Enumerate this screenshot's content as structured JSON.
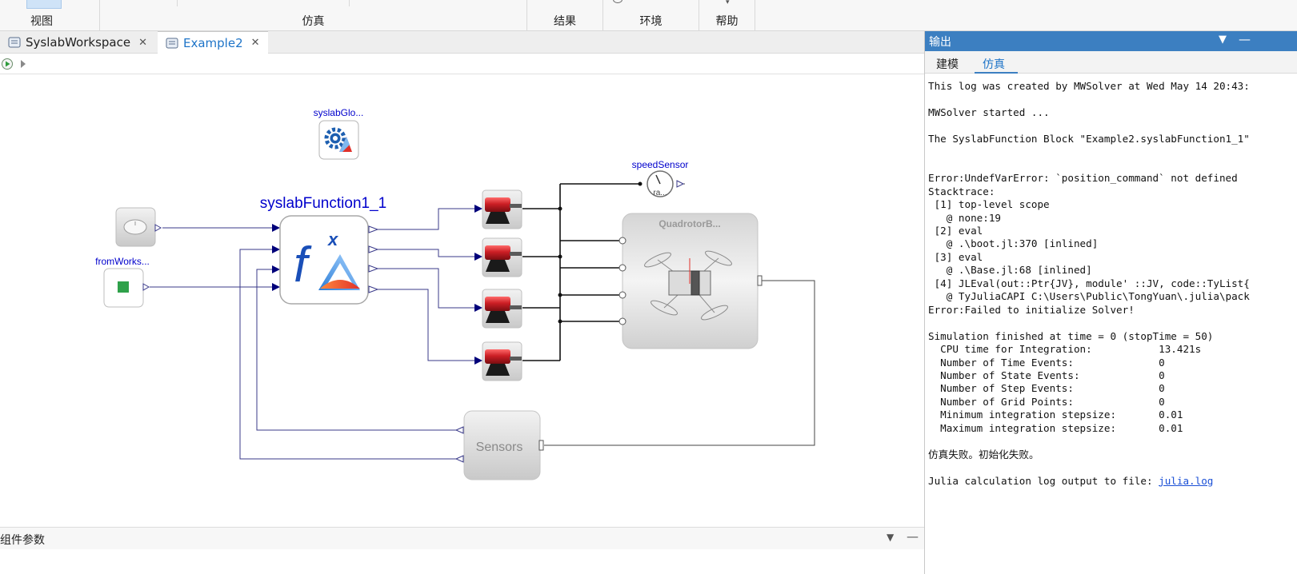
{
  "ribbon": {
    "groups": [
      {
        "label": "视图"
      },
      {
        "label": "仿真"
      },
      {
        "label": "结果"
      },
      {
        "label": "环境"
      },
      {
        "label": "帮助"
      }
    ]
  },
  "editor_tabs": [
    {
      "label": "SyslabWorkspace",
      "active": false
    },
    {
      "label": "Example2",
      "active": true
    }
  ],
  "diagram": {
    "blocks": {
      "global": {
        "label": "syslabGlo..."
      },
      "function": {
        "label": "syslabFunction1_1"
      },
      "from_workspace": {
        "label": "fromWorks..."
      },
      "speed_sensor": {
        "label": "speedSensor",
        "inner": "ra..."
      },
      "quadrotor": {
        "label": "QuadrotorB..."
      },
      "sensors": {
        "label": "Sensors"
      }
    },
    "colors": {
      "label_blue": "#0000cc",
      "wire": "#3a3a8a",
      "motor_red": "#cc1f25"
    }
  },
  "bottom_panel": {
    "title": "组件参数"
  },
  "output_panel": {
    "title": "输出",
    "tabs": [
      {
        "label": "建模",
        "active": false
      },
      {
        "label": "仿真",
        "active": true
      }
    ],
    "log_lines": [
      "This log was created by MWSolver at Wed May 14 20:43:",
      "",
      "MWSolver started ...",
      "",
      "The SyslabFunction Block \"Example2.syslabFunction1_1\"",
      "",
      "",
      "Error:UndefVarError: `position_command` not defined",
      "Stacktrace:",
      " [1] top-level scope",
      "   @ none:19",
      " [2] eval",
      "   @ .\\boot.jl:370 [inlined]",
      " [3] eval",
      "   @ .\\Base.jl:68 [inlined]",
      " [4] JLEval(out::Ptr{JV}, module' ::JV, code::TyList{",
      "   @ TyJuliaCAPI C:\\Users\\Public\\TongYuan\\.julia\\pack",
      "Error:Failed to initialize Solver!",
      "",
      "Simulation finished at time = 0 (stopTime = 50)",
      "  CPU time for Integration:           13.421s",
      "  Number of Time Events:              0",
      "  Number of State Events:             0",
      "  Number of Step Events:              0",
      "  Number of Grid Points:              0",
      "  Minimum integration stepsize:       0.01",
      "  Maximum integration stepsize:       0.01",
      "",
      "仿真失败。初始化失败。",
      ""
    ],
    "log_link_prefix": "Julia calculation log output to file: ",
    "log_link_text": "julia.log"
  }
}
